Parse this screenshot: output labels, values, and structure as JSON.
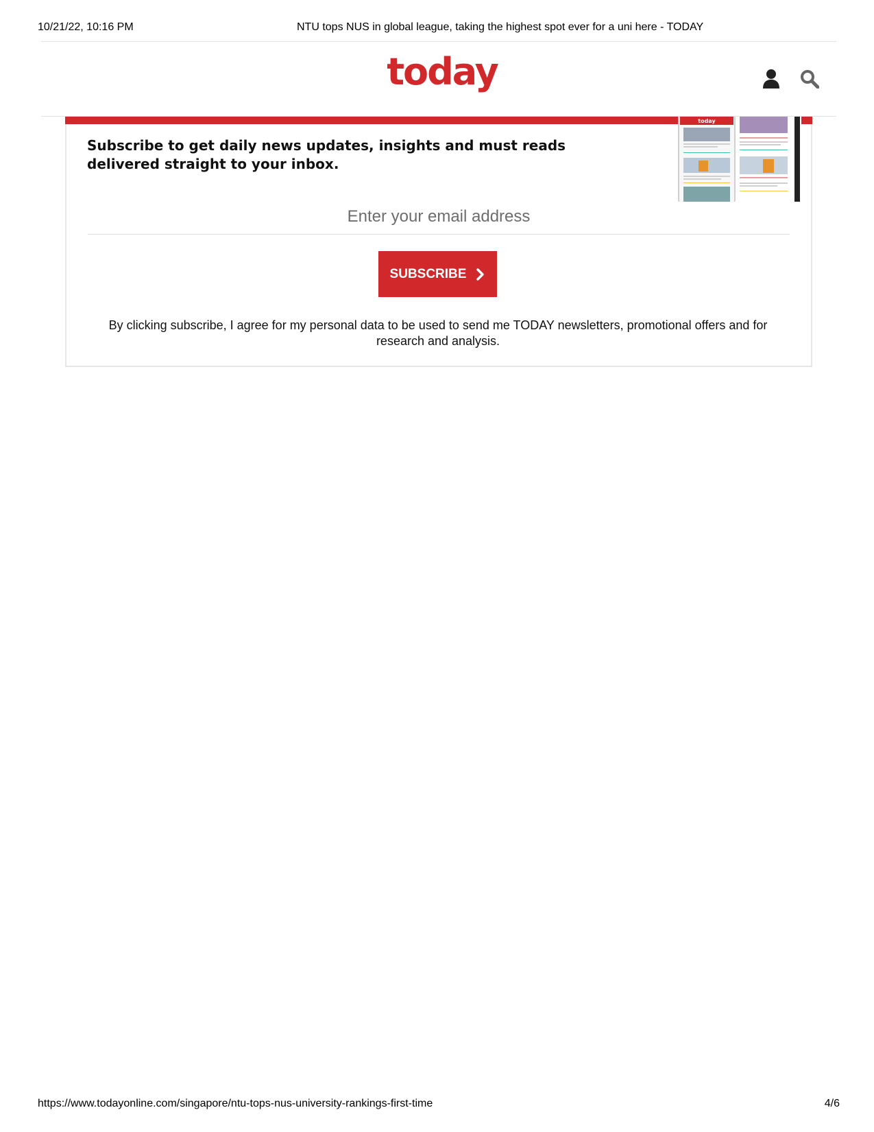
{
  "print_header": {
    "datetime": "10/21/22, 10:16 PM",
    "page_title": "NTU tops NUS in global league, taking the highest spot ever for a uni here - TODAY"
  },
  "site_header": {
    "logo_text": "today",
    "brand_color": "#d1282b",
    "icons": [
      "user-icon",
      "search-icon"
    ]
  },
  "newsletter": {
    "headline": "Subscribe to get daily news updates, insights and must reads delivered straight to your inbox.",
    "email_placeholder": "Enter your email address",
    "subscribe_label": "SUBSCRIBE",
    "consent_text": "By clicking subscribe, I agree for my personal data to be used to send me TODAY newsletters, promotional offers and for research and analysis.",
    "preview_logo": "today"
  },
  "print_footer": {
    "url": "https://www.todayonline.com/singapore/ntu-tops-nus-university-rankings-first-time",
    "page_number": "4/6"
  }
}
